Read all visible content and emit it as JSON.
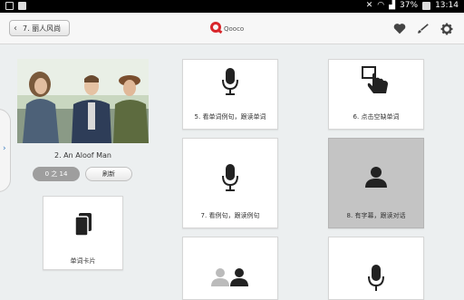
{
  "status_bar": {
    "battery": "37%",
    "time": "13:14"
  },
  "app_bar": {
    "back_label": "7. 丽人风尚",
    "logo_text": "Qooco",
    "brand_color": "#d8262b",
    "icons": [
      "heart-icon",
      "brush-icon",
      "gear-icon"
    ]
  },
  "lesson": {
    "title": "2. An Aloof Man",
    "counter": "0 之 14",
    "refresh_label": "刷新"
  },
  "cards": {
    "flashcards": "单词卡片",
    "c5": "5. 看单词例句，跟读单词",
    "c6": "6. 点击空缺单词",
    "c7": "7. 看例句，跟读例句",
    "c8": "8. 有字幕，跟读对话"
  },
  "selected_card": "8. 有字幕，跟读对话"
}
